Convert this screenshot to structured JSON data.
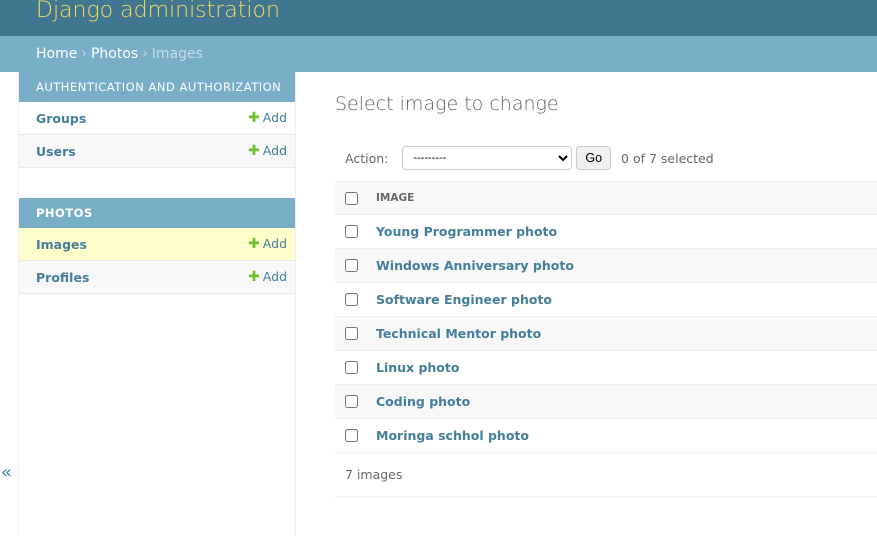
{
  "header": {
    "title": "Django administration"
  },
  "breadcrumb": {
    "home": "Home",
    "app": "Photos",
    "current": "Images",
    "sep": "›"
  },
  "sidebar": {
    "modules": [
      {
        "caption": "AUTHENTICATION AND AUTHORIZATION",
        "items": [
          {
            "label": "Groups",
            "add": "Add"
          },
          {
            "label": "Users",
            "add": "Add"
          }
        ]
      },
      {
        "caption": "PHOTOS",
        "items": [
          {
            "label": "Images",
            "add": "Add",
            "selected": true
          },
          {
            "label": "Profiles",
            "add": "Add"
          }
        ]
      }
    ],
    "collapse": "«"
  },
  "main": {
    "title": "Select image to change",
    "action_label": "Action:",
    "action_value": "---------",
    "go": "Go",
    "selected_count": "0 of 7 selected",
    "column": "IMAGE",
    "rows": [
      "Young Programmer photo",
      "Windows Anniversary photo",
      "Software Engineer photo",
      "Technical Mentor photo",
      "Linux photo",
      "Coding photo",
      "Moringa schhol photo"
    ],
    "footer": "7 images"
  },
  "colors": {
    "header": "#417690",
    "breadcrumb": "#79aec8",
    "title": "#f5dd5d",
    "link": "#447e9b",
    "add": "#70bf2b",
    "selected_row": "#ffffcc"
  }
}
